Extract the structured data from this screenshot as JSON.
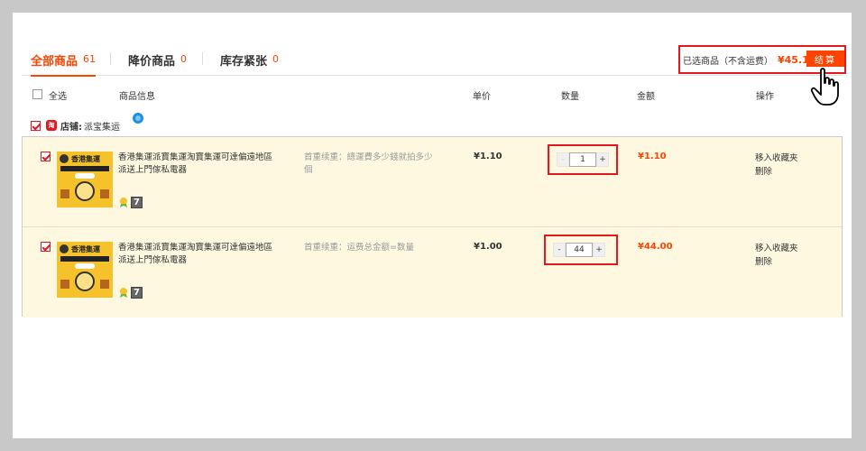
{
  "tabs": [
    {
      "label": "全部商品",
      "count": "61"
    },
    {
      "label": "降价商品",
      "count": "0"
    },
    {
      "label": "库存紧张",
      "count": "0"
    }
  ],
  "summary": {
    "label": "已选商品（不含运费）",
    "amount": "¥45.10",
    "checkout_label": "结算"
  },
  "header": {
    "select_all": "全选",
    "product_info": "商品信息",
    "unit_price": "单价",
    "quantity": "数量",
    "amount": "金额",
    "operation": "操作"
  },
  "shop": {
    "badge": "淘",
    "label": "店铺:",
    "name": "派宝集运"
  },
  "items": [
    {
      "title": "香港集運派寶集運淘寶集運可達偏遠地區派送上門傢私電器",
      "thumb_title": "香港集運",
      "shipping": "首重续重：總運費多少錢就拍多少個",
      "price": "¥1.10",
      "quantity": "1",
      "amount": "¥1.10",
      "ops": [
        "移入收藏夹",
        "删除"
      ],
      "seven_badge": "7"
    },
    {
      "title": "香港集運派寶集運淘寶集運可達偏遠地區派送上門傢私電器",
      "thumb_title": "香港集運",
      "shipping": "首重续重：运费总金额=数量",
      "price": "¥1.00",
      "quantity": "44",
      "amount": "¥44.00",
      "ops": [
        "移入收藏夹",
        "删除"
      ],
      "seven_badge": "7"
    }
  ],
  "qty_buttons": {
    "minus": "-",
    "plus": "+"
  },
  "colors": {
    "accent": "#ff4400",
    "highlight": "#e4171e",
    "row_bg": "#fff8e1"
  }
}
